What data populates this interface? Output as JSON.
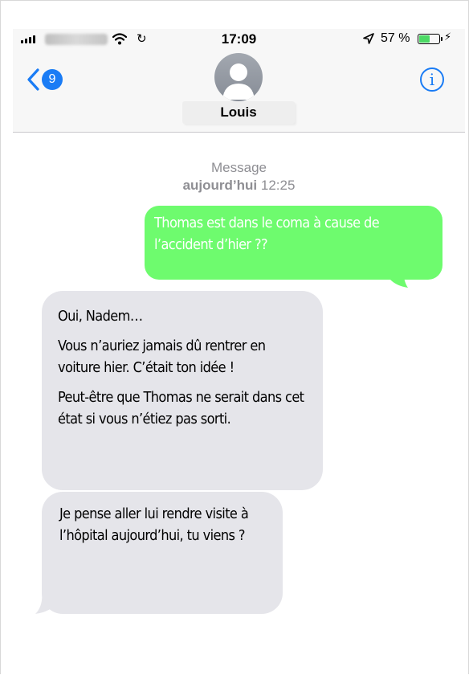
{
  "status_bar": {
    "time": "17:09",
    "battery_percent": "57 %",
    "battery_level": 0.57
  },
  "header": {
    "back_count": "9",
    "contact_name": "Louis",
    "info_label": "i"
  },
  "thread": {
    "service_label": "Message",
    "date_label": "aujourd’hui",
    "time_label": "12:25"
  },
  "messages": [
    {
      "direction": "outgoing",
      "text": "Thomas est dans le coma à cause de l’accident d’hier ??"
    },
    {
      "direction": "incoming",
      "paragraphs": [
        "Oui, Nadem…",
        "Vous n’auriez jamais dû rentrer en voiture hier. C’était ton idée !",
        "Peut-être que Thomas ne serait dans cet état si vous n’étiez pas sorti."
      ]
    },
    {
      "direction": "incoming",
      "text": "Je pense aller lui rendre visite à l’hôpital aujourd’hui, tu viens ?"
    }
  ],
  "colors": {
    "outgoing_bubble": "#6efb6e",
    "incoming_bubble": "#e5e5ea",
    "accent": "#1a7cf5"
  }
}
